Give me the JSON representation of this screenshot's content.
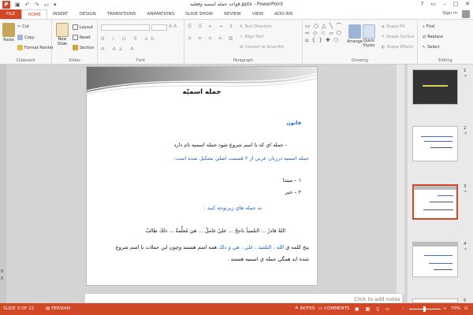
{
  "app": {
    "window_title": "قواعد جمله اسمیه وفعلیه.pptx - PowerPoint",
    "sign_in": "Sign in",
    "help": "?"
  },
  "tabs": [
    "FILE",
    "HOME",
    "INSERT",
    "DESIGN",
    "TRANSITIONS",
    "ANIMATIONS",
    "SLIDE SHOW",
    "REVIEW",
    "VIEW",
    "ADD-INS"
  ],
  "ribbon": {
    "clipboard": {
      "label": "Clipboard",
      "paste": "Paste",
      "cut": "Cut",
      "copy": "Copy",
      "format_painter": "Format Painter"
    },
    "slides": {
      "label": "Slides",
      "new_slide": "New",
      "new_slide2": "Slide",
      "layout": "Layout",
      "reset": "Reset",
      "section": "Section"
    },
    "font": {
      "label": "Font"
    },
    "paragraph": {
      "label": "Paragraph",
      "text_direction": "Text Direction",
      "align_text": "Align Text",
      "convert_smartart": "Convert to SmartArt"
    },
    "drawing": {
      "label": "Drawing",
      "arrange": "Arrange",
      "quick_styles": "Quick",
      "quick_styles2": "Styles",
      "shape_fill": "Shape Fill",
      "shape_outline": "Shape Outline",
      "shape_effects": "Shape Effects"
    },
    "editing": {
      "label": "Editing",
      "find": "Find",
      "replace": "Replace",
      "select": "Select"
    }
  },
  "thumbnails": [
    {
      "num": "1",
      "star": "*"
    },
    {
      "num": "2",
      "star": "*"
    },
    {
      "num": "3",
      "star": "*"
    },
    {
      "num": "4",
      "star": "*"
    },
    {
      "num": "5",
      "star": ""
    }
  ],
  "slide": {
    "title": "جمله اسمیّه",
    "heading": "قانون",
    "line1": "- جمله اي كه با اسم شروع شود جمله اسميه نام دارد",
    "line2": "جمله اسميه درزبان عربي از ۲ قسمت اصلي تشكيل شده است:",
    "item1": "۱ – مبتدا",
    "item2": "۲ – خبر",
    "line3": "به جمله هاي زيرتوجه كنيد :",
    "examples": "اللهُ قادرٌ ... التلميذُ ناجحٌ ... عليٌ عاملٌ ... هيَ مُعلِّمةٌ ... ذلكَ طالبٌ",
    "para_prefix": "پنج كلمه ي",
    "para_blue": "الله ، التلميذ ، علي ، هي و ذلك",
    "para_suffix": "همه اسم هستند وچون اين جملات با اسم شروع",
    "para_line2": "شده اند همگي جمله ي اسميه هستند ."
  },
  "notes_placeholder": "Click to add notes",
  "side_numbers": [
    "8",
    "8"
  ],
  "status": {
    "slide_of": "SLIDE 3 OF 22",
    "language": "PERSIAN",
    "notes": "NOTES",
    "comments": "COMMENTS",
    "zoom": "70%"
  },
  "colors": {
    "accent": "#d24726",
    "link_blue": "#2067c9"
  }
}
